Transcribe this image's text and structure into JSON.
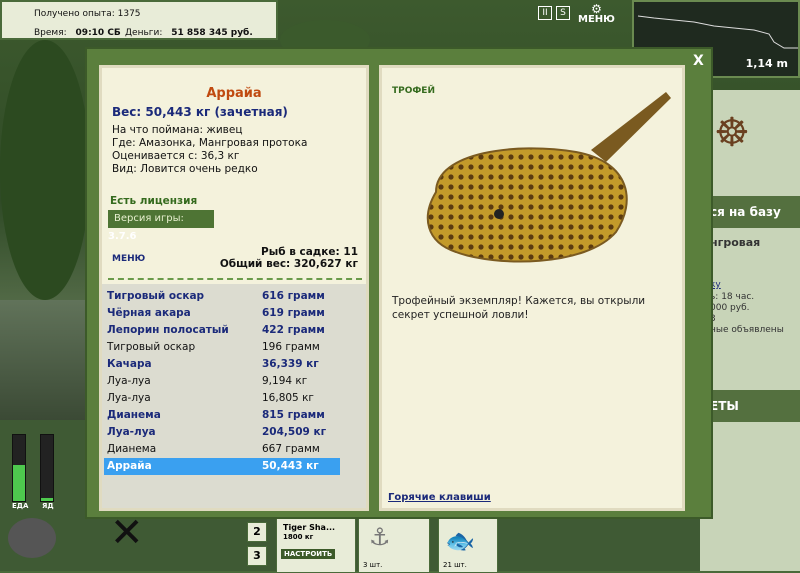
{
  "topbar": {
    "experience_label": "Получено опыта:",
    "experience_value": "1375",
    "time_label": "Время:",
    "time_value": "09:10 СБ",
    "money_label": "Деньги:",
    "money_value": "51 858 345 руб."
  },
  "toolbar": {
    "pause_icon": "II",
    "sound_icon": "S",
    "menu_label": "МЕНЮ"
  },
  "minimap": {
    "depth": "1,14 m"
  },
  "right_panel": {
    "base_heading": "ся на базу",
    "location": "нгровая",
    "link": "ку",
    "line1": "ь: 18 час.",
    "line2": "000 руб.",
    "line3": "3",
    "line4": "ные объявлены",
    "secrets_heading": "ЕТЫ"
  },
  "bottom": {
    "food_label": "ЕДА",
    "poison_label": "ЯД",
    "slot_num_2": "2",
    "slot_num_3": "3",
    "lure_name": "Tiger Sha...",
    "lure_weight": "1800 кг",
    "setup_button": "НАСТРОИТЬ",
    "count1": "3 шт.",
    "count2": "21 шт.",
    "food_level": 0.55,
    "poison_level": 0.05
  },
  "modal": {
    "close_label": "X",
    "fish_name": "Аррайа",
    "weight_line": "Вес: 50,443 кг (зачетная)",
    "caught_on": "На что поймана: живец",
    "where": "Где: Амазонка, Мангровая протока",
    "valued_from": "Оценивается с: 36,3 кг",
    "rarity": "Вид: Ловится очень редко",
    "license": "Есть лицензия",
    "version_label": "Версия игры:",
    "version_value": "3.7.6",
    "menu_label": "МЕНЮ",
    "fish_in_net": "Рыб в садке: 11",
    "total_weight": "Общий вес: 320,627 кг",
    "catch_list": [
      {
        "name": "Тигровый оскар",
        "weight": "616 грамм",
        "trophy": true
      },
      {
        "name": "Чёрная акара",
        "weight": "619 грамм",
        "trophy": true
      },
      {
        "name": "Лепорин полосатый",
        "weight": "422 грамм",
        "trophy": true
      },
      {
        "name": "Тигровый оскар",
        "weight": "196 грамм",
        "trophy": false
      },
      {
        "name": "Качара",
        "weight": "36,339 кг",
        "trophy": true
      },
      {
        "name": "Луа-луа",
        "weight": "9,194 кг",
        "trophy": false
      },
      {
        "name": "Луа-луа",
        "weight": "16,805 кг",
        "trophy": false
      },
      {
        "name": "Дианема",
        "weight": "815 грамм",
        "trophy": true
      },
      {
        "name": "Луа-луа",
        "weight": "204,509 кг",
        "trophy": true
      },
      {
        "name": "Дианема",
        "weight": "667 грамм",
        "trophy": false
      },
      {
        "name": "Аррайа",
        "weight": "50,443 кг",
        "trophy": true,
        "selected": true
      }
    ],
    "trophy_title": "ТРОФЕЙ",
    "trophy_desc": "Трофейный экземпляр! Кажется, вы открыли секрет успешной ловли!",
    "hotkeys": "Горячие клавиши"
  }
}
